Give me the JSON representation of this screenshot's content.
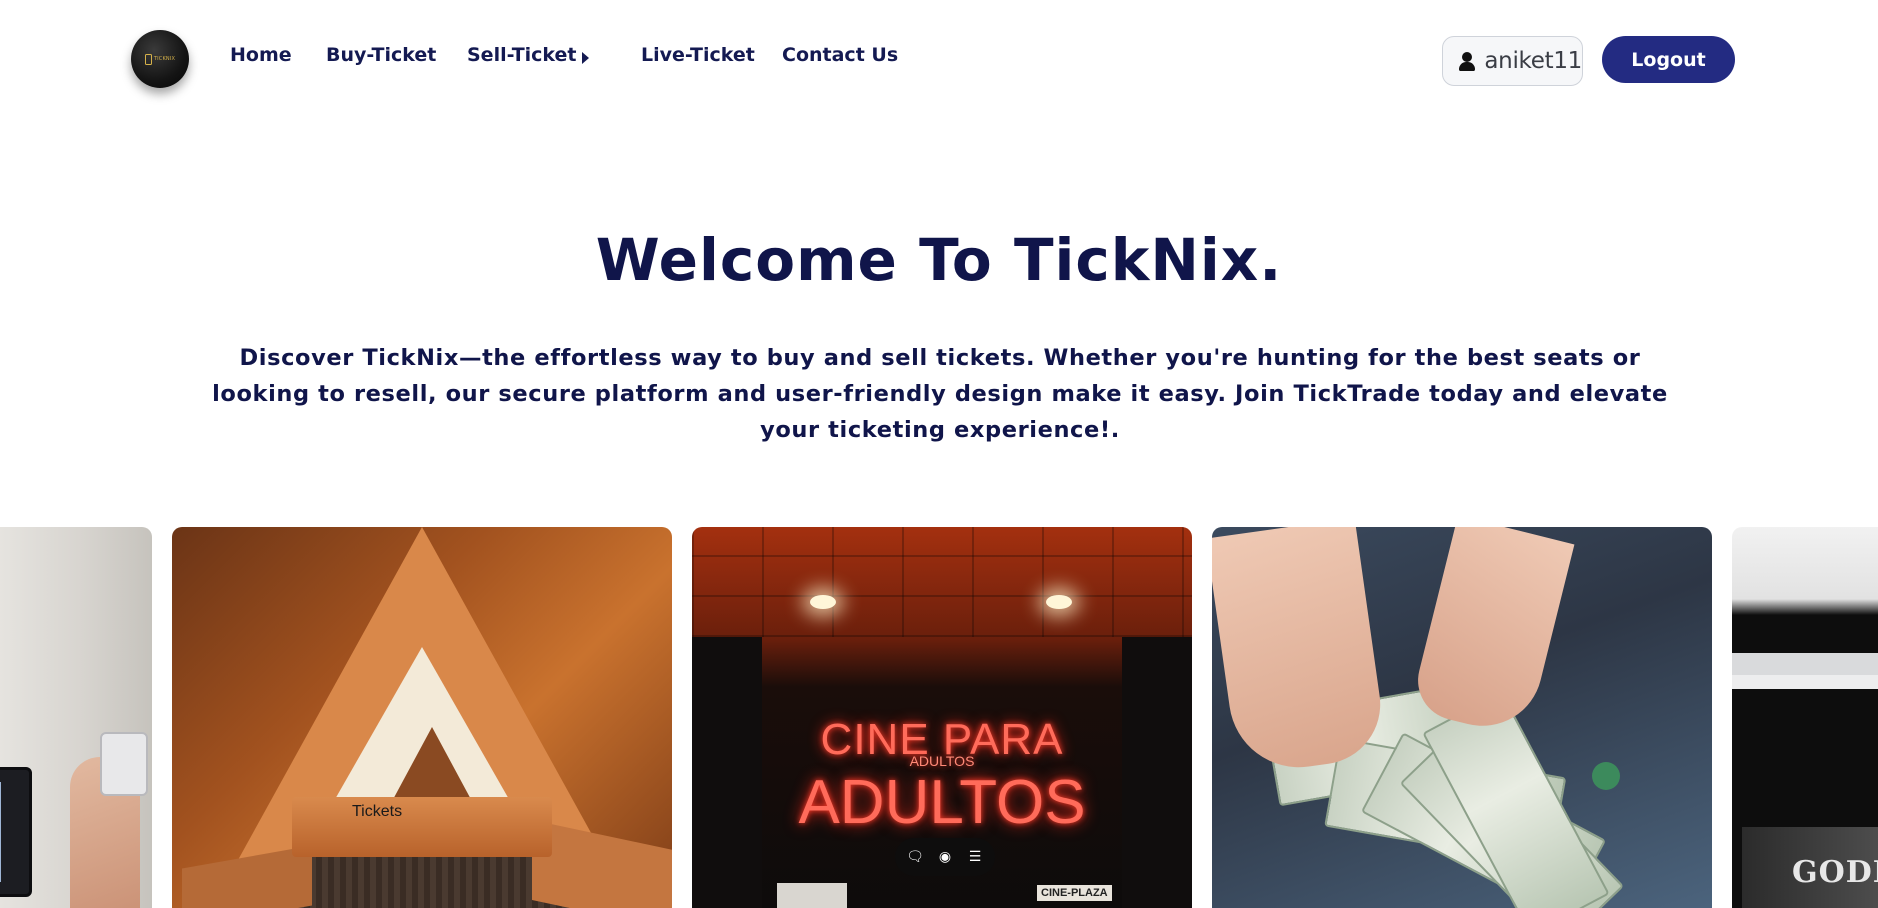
{
  "navbar": {
    "logo_text": "TICKNIX",
    "links": {
      "home": "Home",
      "buy": "Buy-Ticket",
      "sell": "Sell-Ticket",
      "live": "Live-Ticket",
      "contact": "Contact Us"
    },
    "user": {
      "icon": "user-icon",
      "name": "aniket11"
    },
    "logout_label": "Logout"
  },
  "hero": {
    "title": "Welcome To TickNix.",
    "description": "Discover TickNix—the effortless way to buy and sell tickets. Whether you're hunting for the best seats or looking to resell, our secure platform and user-friendly design make it easy. Join TickTrade today and elevate your ticketing experience!."
  },
  "carousel": {
    "cards": [
      {
        "image": "office-hand-holding-phone"
      },
      {
        "image": "wooden-triangle-ticket-booth",
        "sign_text": "Tickets"
      },
      {
        "image": "neon-cinema-entrance",
        "neon_line1": "CINE PARA",
        "neon_small": "ADULTOS",
        "neon_line2": "ADULTOS",
        "plaza_text": "CINE-PLAZA"
      },
      {
        "image": "hands-holding-dollar-bills"
      },
      {
        "image": "netflix-on-screen",
        "poster_text": "GODLESS"
      }
    ],
    "overlay_toolbar": {
      "icons": [
        "comment-icon",
        "eye-icon",
        "menu-icon"
      ]
    }
  },
  "colors": {
    "primary": "#232b82",
    "heading": "#10154a",
    "nav_text": "#141a52",
    "background": "#ffffff"
  }
}
